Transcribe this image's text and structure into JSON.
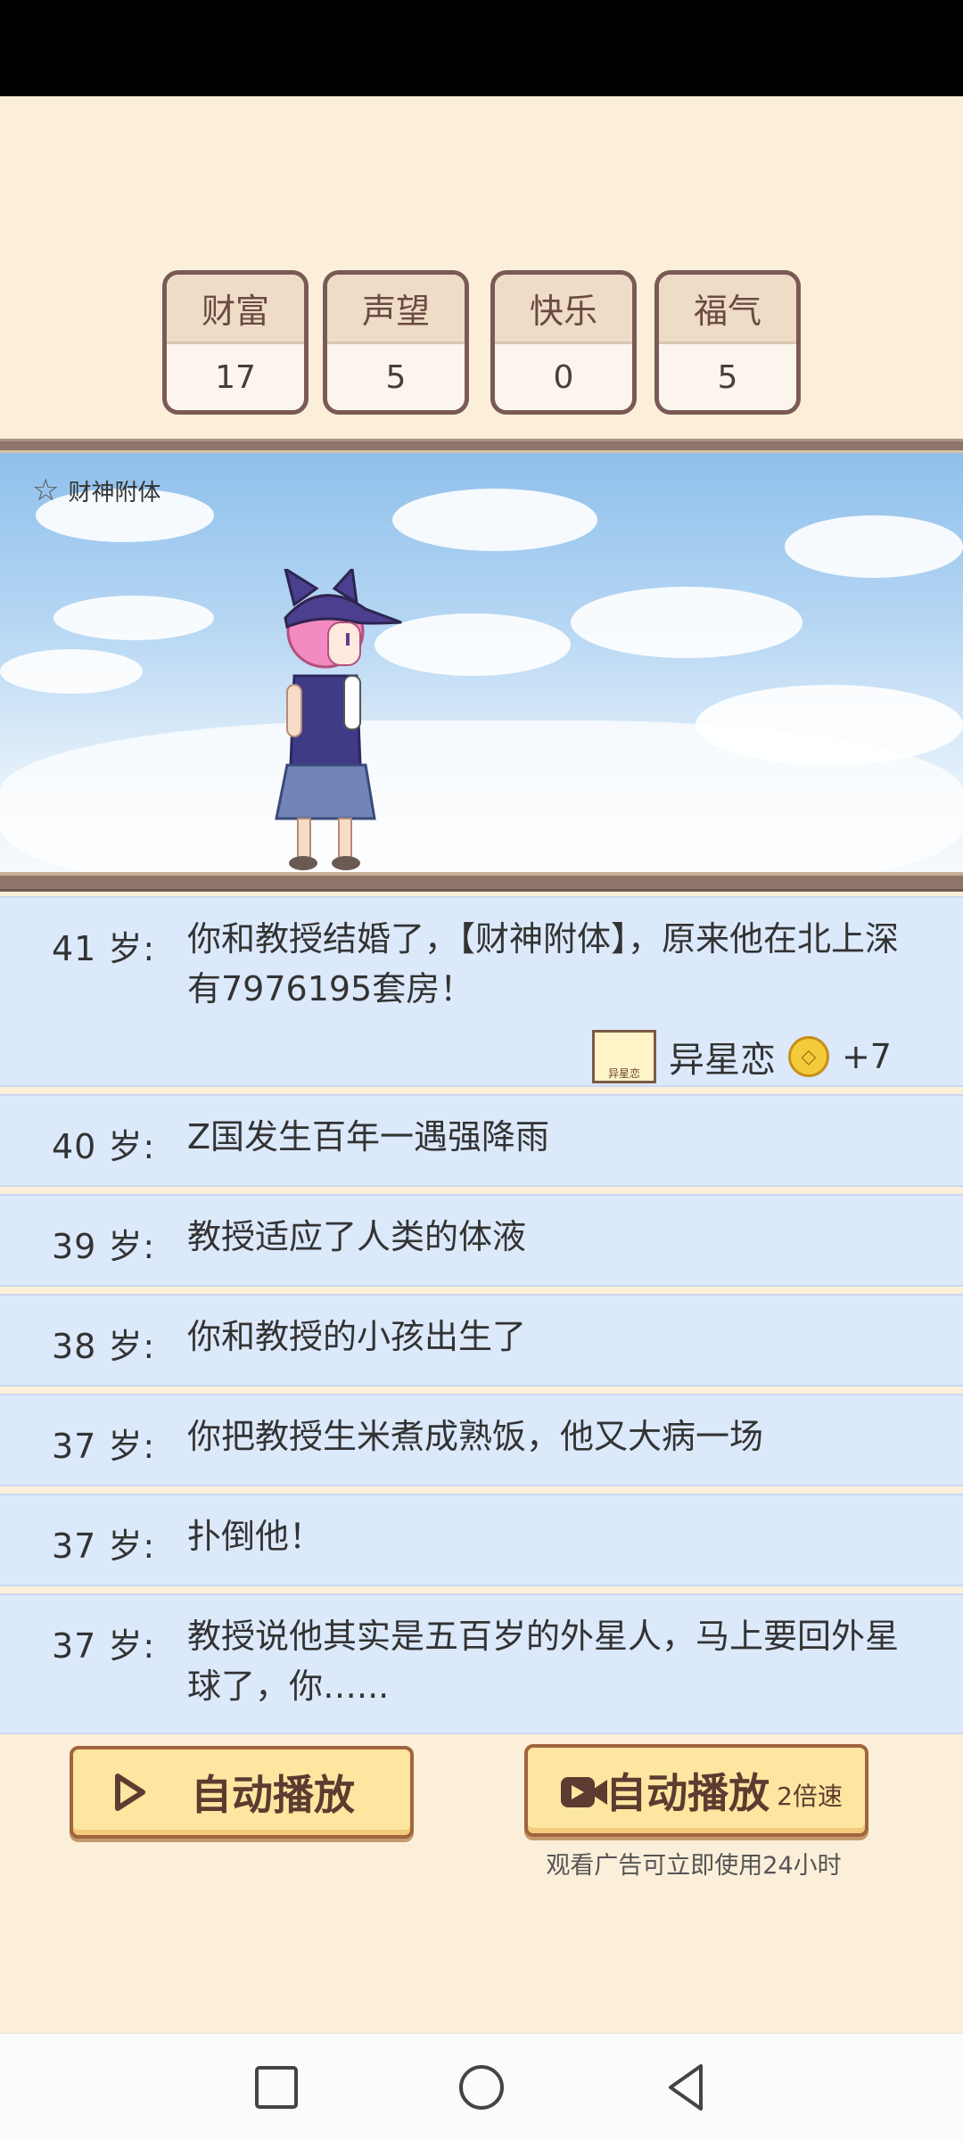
{
  "stats": [
    {
      "label": "财富",
      "value": "17"
    },
    {
      "label": "声望",
      "value": "5"
    },
    {
      "label": "快乐",
      "value": "0"
    },
    {
      "label": "福气",
      "value": "5"
    }
  ],
  "scene": {
    "buff_label": "财神附体"
  },
  "log": [
    {
      "age": "41 岁:",
      "text": "你和教授结婚了，【财神附体】，原来他在北上深有7976195套房！",
      "reward": {
        "name": "异星恋",
        "badge": "异星恋",
        "amount": "+7"
      }
    },
    {
      "age": "40 岁:",
      "text": "Z国发生百年一遇强降雨"
    },
    {
      "age": "39 岁:",
      "text": "教授适应了人类的体液"
    },
    {
      "age": "38 岁:",
      "text": "你和教授的小孩出生了"
    },
    {
      "age": "37 岁:",
      "text": "你把教授生米煮成熟饭，他又大病一场"
    },
    {
      "age": "37 岁:",
      "text": "扑倒他！"
    },
    {
      "age": "37 岁:",
      "text": "教授说他其实是五百岁的外星人，马上要回外星球了，你…..."
    }
  ],
  "buttons": {
    "auto_play": "自动播放",
    "auto_play_ad": "自动播放",
    "speed_label": "2倍速",
    "ad_note": "观看广告可立即使用24小时"
  },
  "colors": {
    "background": "#fcefd9",
    "log_row": "#dce9fb",
    "button_fill": "#fde6a0",
    "button_border": "#a0643e"
  }
}
